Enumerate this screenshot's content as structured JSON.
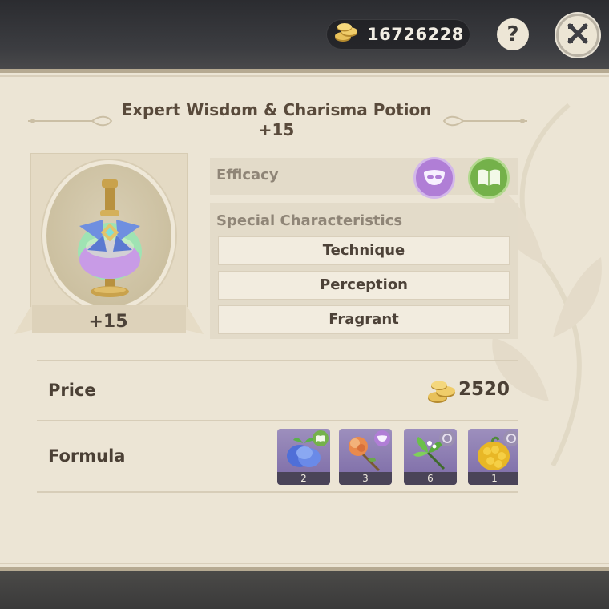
{
  "header": {
    "currency_amount": "16726228",
    "currency_icon": "mora-coins-icon",
    "help_label": "?",
    "close_icon": "close-icon"
  },
  "item": {
    "title": "Expert Wisdom & Charisma Potion",
    "title_level": "+15",
    "level": "+15",
    "image": "potion-icon"
  },
  "efficacy": {
    "label": "Efficacy",
    "icons": [
      {
        "name": "mask-icon",
        "color": "#b07ed6"
      },
      {
        "name": "book-icon",
        "color": "#74b14a"
      }
    ]
  },
  "special": {
    "label": "Special Characteristics",
    "traits": [
      "Technique",
      "Perception",
      "Fragrant"
    ]
  },
  "price": {
    "label": "Price",
    "value": "2520"
  },
  "formula": {
    "label": "Formula",
    "ingredients": [
      {
        "icon": "blue-fruit-icon",
        "badge": "book-icon",
        "count": "2"
      },
      {
        "icon": "orange-flower-icon",
        "badge": "mask-icon",
        "count": "3"
      },
      {
        "icon": "green-herb-icon",
        "badge": "ring-icon",
        "count": "6"
      },
      {
        "icon": "golden-berry-icon",
        "badge": "ring-icon",
        "count": "1"
      }
    ]
  },
  "colors": {
    "panel_bg": "#ece5d5",
    "text_dark": "#4b4035",
    "text_muted": "#8f8577",
    "ingredient_bg": "#8d7eb3"
  }
}
